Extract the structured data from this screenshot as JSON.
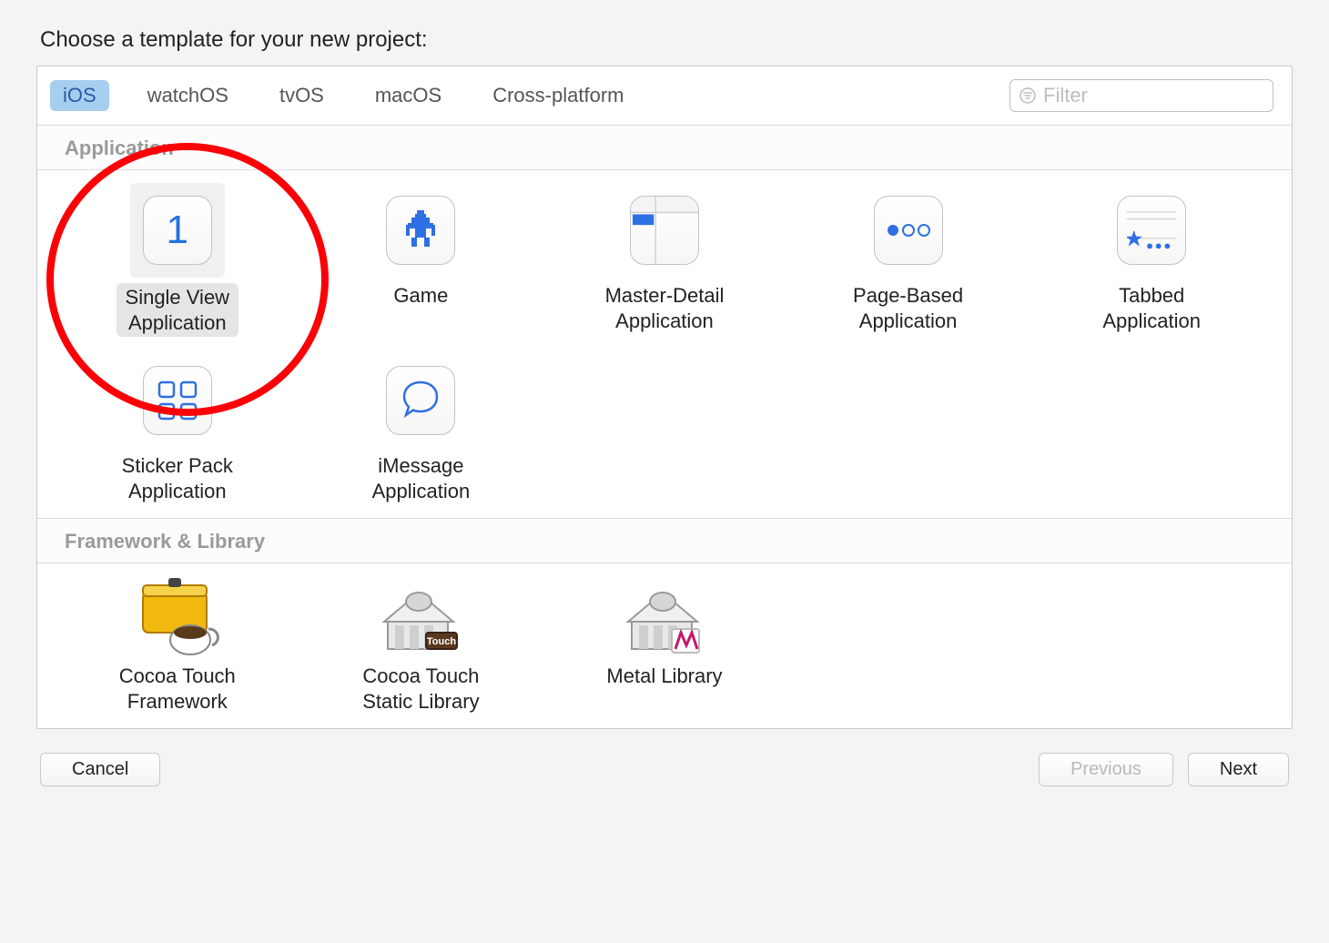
{
  "heading": "Choose a template for your new project:",
  "tabs": [
    "iOS",
    "watchOS",
    "tvOS",
    "macOS",
    "Cross-platform"
  ],
  "selected_tab": 0,
  "filter_placeholder": "Filter",
  "sections": {
    "application": {
      "title": "Application",
      "items": [
        {
          "label": "Single View\nApplication",
          "icon": "single-view",
          "selected": true
        },
        {
          "label": "Game",
          "icon": "game"
        },
        {
          "label": "Master-Detail\nApplication",
          "icon": "master-detail"
        },
        {
          "label": "Page-Based\nApplication",
          "icon": "page-based"
        },
        {
          "label": "Tabbed\nApplication",
          "icon": "tabbed"
        },
        {
          "label": "Sticker Pack\nApplication",
          "icon": "sticker-pack"
        },
        {
          "label": "iMessage\nApplication",
          "icon": "imessage"
        }
      ]
    },
    "framework": {
      "title": "Framework & Library",
      "items": [
        {
          "label": "Cocoa Touch\nFramework",
          "icon": "cocoa-touch-framework"
        },
        {
          "label": "Cocoa Touch\nStatic Library",
          "icon": "cocoa-touch-static"
        },
        {
          "label": "Metal Library",
          "icon": "metal-library"
        }
      ]
    }
  },
  "footer": {
    "cancel": "Cancel",
    "previous": "Previous",
    "next": "Next",
    "previous_disabled": true
  }
}
